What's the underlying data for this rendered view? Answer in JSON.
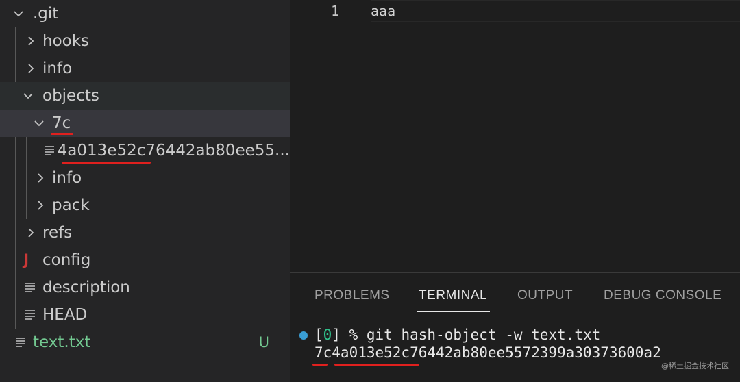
{
  "explorer": {
    "items": [
      {
        "label": ".git",
        "kind": "folder-open"
      },
      {
        "label": "hooks",
        "kind": "folder-closed"
      },
      {
        "label": "info",
        "kind": "folder-closed"
      },
      {
        "label": "objects",
        "kind": "folder-open"
      },
      {
        "label": "7c",
        "kind": "folder-open"
      },
      {
        "label": "4a013e52c76442ab80ee55...",
        "kind": "file"
      },
      {
        "label": "info",
        "kind": "folder-closed"
      },
      {
        "label": "pack",
        "kind": "folder-closed"
      },
      {
        "label": "refs",
        "kind": "folder-closed"
      },
      {
        "label": "config",
        "kind": "json-file",
        "icon_glyph": "J"
      },
      {
        "label": "description",
        "kind": "file"
      },
      {
        "label": "HEAD",
        "kind": "file"
      },
      {
        "label": "text.txt",
        "kind": "file-modified",
        "status": "U"
      }
    ],
    "colors": {
      "modified": "#73c991",
      "highlight_underline": "#e0201e"
    }
  },
  "editor": {
    "line_number": "1",
    "line_text": "aaa"
  },
  "panel": {
    "tabs": [
      "PROBLEMS",
      "TERMINAL",
      "OUTPUT",
      "DEBUG CONSOLE"
    ],
    "active_tab": "TERMINAL",
    "terminal": {
      "prompt_open": "[",
      "prompt_index": "0",
      "prompt_close": "] %",
      "command": "git hash-object -w text.txt",
      "output": "7c4a013e52c76442ab80ee5572399a30373600a2"
    }
  },
  "watermark": "@稀土掘金技术社区"
}
